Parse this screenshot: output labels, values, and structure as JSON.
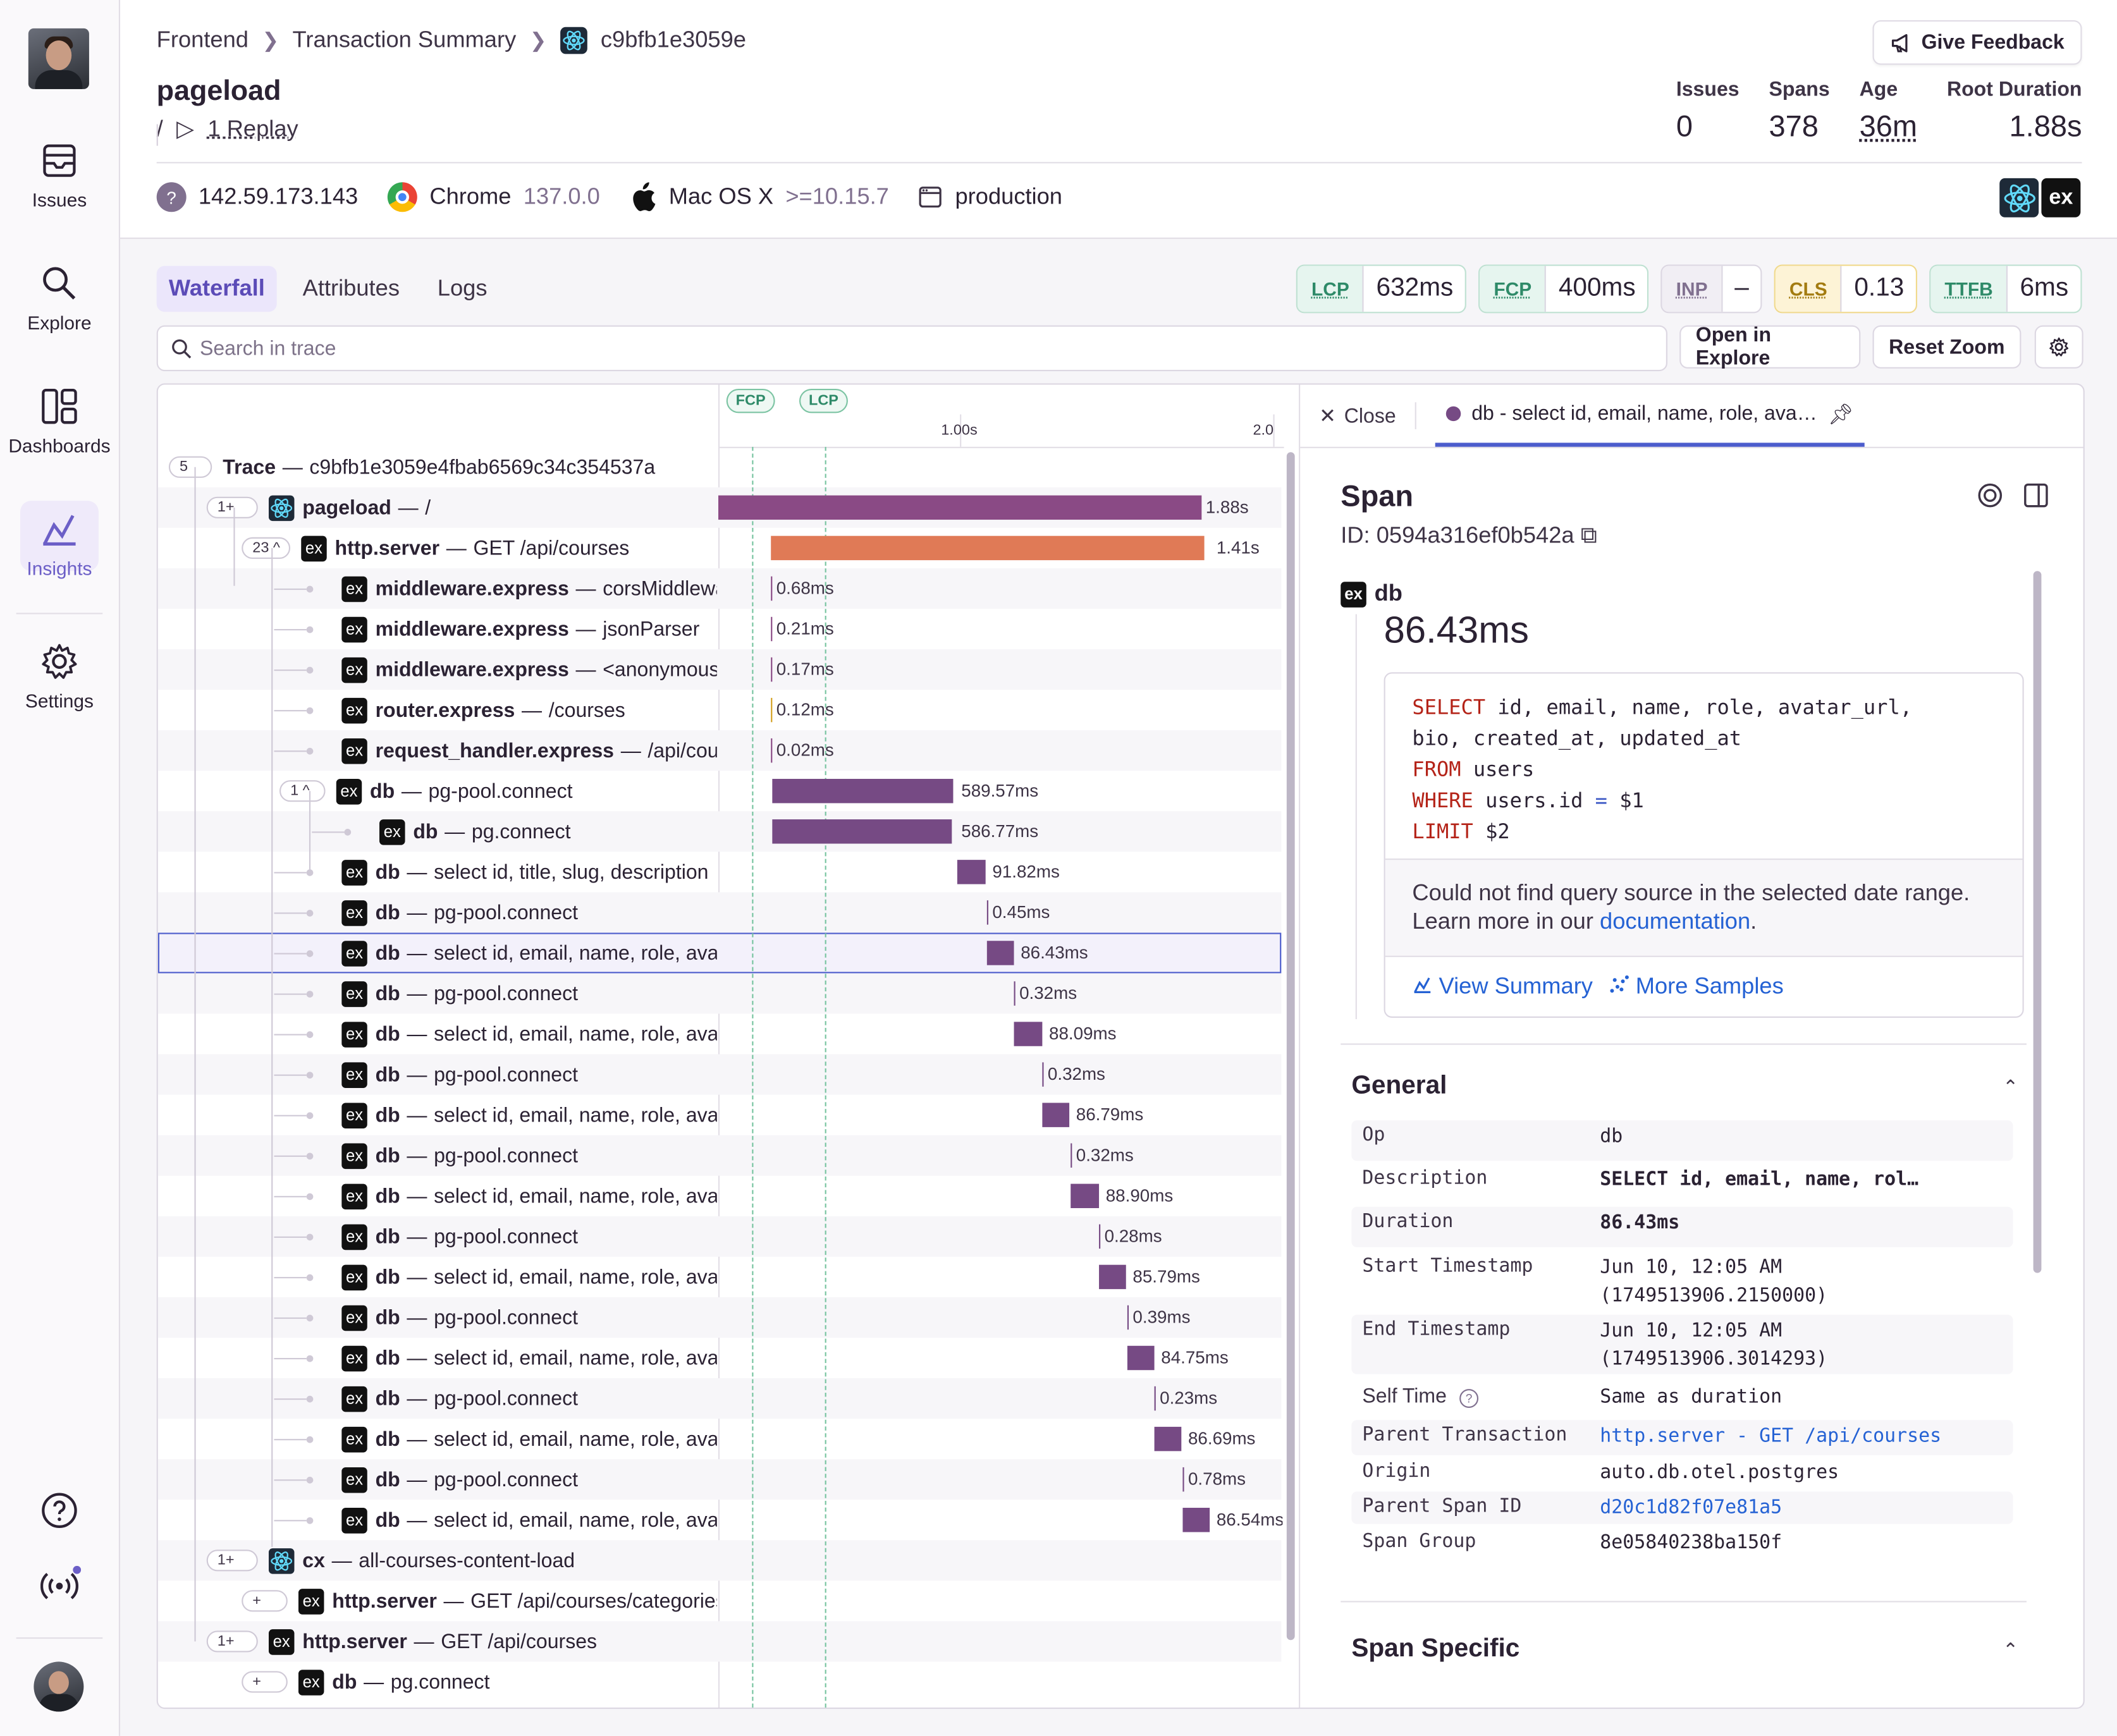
{
  "sidebar": {
    "items": [
      {
        "label": "Issues",
        "icon": "issues-icon"
      },
      {
        "label": "Explore",
        "icon": "search-icon"
      },
      {
        "label": "Dashboards",
        "icon": "dashboards-icon"
      },
      {
        "label": "Insights",
        "icon": "insights-icon"
      },
      {
        "label": "Settings",
        "icon": "gear-icon"
      }
    ],
    "accent": "#6c5fc7"
  },
  "breadcrumbs": [
    "Frontend",
    "Transaction Summary",
    "c9bfb1e3059e"
  ],
  "header": {
    "title": "pageload",
    "route": "/",
    "replay": "1 Replay",
    "feedback": "Give Feedback",
    "stats": [
      {
        "label": "Issues",
        "value": "0"
      },
      {
        "label": "Spans",
        "value": "378"
      },
      {
        "label": "Age",
        "value": "36m"
      },
      {
        "label": "Root Duration",
        "value": "1.88s"
      }
    ],
    "ip": "142.59.173.143",
    "browser": "Chrome",
    "browser_version": "137.0.0",
    "os": "Mac OS X",
    "os_version": ">=10.15.7",
    "environment": "production"
  },
  "tabs": [
    "Waterfall",
    "Attributes",
    "Logs"
  ],
  "vitals": [
    {
      "key": "LCP",
      "value": "632ms"
    },
    {
      "key": "FCP",
      "value": "400ms"
    },
    {
      "key": "INP",
      "value": "–"
    },
    {
      "key": "CLS",
      "value": "0.13"
    },
    {
      "key": "TTFB",
      "value": "6ms"
    }
  ],
  "toolbar": {
    "search_placeholder": "Search in trace",
    "open_explore": "Open in Explore",
    "reset_zoom": "Reset Zoom"
  },
  "timeline": {
    "ticks": [
      "1.00s",
      "2.0"
    ],
    "markers": [
      "FCP",
      "LCP"
    ]
  },
  "trace": {
    "rows": [
      {
        "count": "5",
        "op": "Trace",
        "desc": "c9bfb1e3059e4fbab6569c34c354537a",
        "duration": ""
      },
      {
        "count": "1+",
        "op": "pageload",
        "desc": "/",
        "duration": "1.88s"
      },
      {
        "count": "23",
        "op": "http.server",
        "desc": "GET /api/courses",
        "duration": "1.41s"
      },
      {
        "op": "middleware.express",
        "desc": "corsMiddleware",
        "duration": "0.68ms"
      },
      {
        "op": "middleware.express",
        "desc": "jsonParser",
        "duration": "0.21ms"
      },
      {
        "op": "middleware.express",
        "desc": "<anonymous>",
        "duration": "0.17ms"
      },
      {
        "op": "router.express",
        "desc": "/courses",
        "duration": "0.12ms"
      },
      {
        "op": "request_handler.express",
        "desc": "/api/courses",
        "duration": "0.02ms"
      },
      {
        "count": "1",
        "op": "db",
        "desc": "pg-pool.connect",
        "duration": "589.57ms"
      },
      {
        "op": "db",
        "desc": "pg.connect",
        "duration": "586.77ms"
      },
      {
        "op": "db",
        "desc": "select id, title, slug, description",
        "duration": "91.82ms"
      },
      {
        "op": "db",
        "desc": "pg-pool.connect",
        "duration": "0.45ms"
      },
      {
        "op": "db",
        "desc": "select id, email, name, role, avatar_url",
        "duration": "86.43ms"
      },
      {
        "op": "db",
        "desc": "pg-pool.connect",
        "duration": "0.32ms"
      },
      {
        "op": "db",
        "desc": "select id, email, name, role, avatar_url",
        "duration": "88.09ms"
      },
      {
        "op": "db",
        "desc": "pg-pool.connect",
        "duration": "0.32ms"
      },
      {
        "op": "db",
        "desc": "select id, email, name, role, avatar_url",
        "duration": "86.79ms"
      },
      {
        "op": "db",
        "desc": "pg-pool.connect",
        "duration": "0.32ms"
      },
      {
        "op": "db",
        "desc": "select id, email, name, role, avatar_url",
        "duration": "88.90ms"
      },
      {
        "op": "db",
        "desc": "pg-pool.connect",
        "duration": "0.28ms"
      },
      {
        "op": "db",
        "desc": "select id, email, name, role, avatar_url",
        "duration": "85.79ms"
      },
      {
        "op": "db",
        "desc": "pg-pool.connect",
        "duration": "0.39ms"
      },
      {
        "op": "db",
        "desc": "select id, email, name, role, avatar_url",
        "duration": "84.75ms"
      },
      {
        "op": "db",
        "desc": "pg-pool.connect",
        "duration": "0.23ms"
      },
      {
        "op": "db",
        "desc": "select id, email, name, role, avatar_url",
        "duration": "86.69ms"
      },
      {
        "op": "db",
        "desc": "pg-pool.connect",
        "duration": "0.78ms"
      },
      {
        "op": "db",
        "desc": "select id, email, name, role, avatar_url",
        "duration": "86.54ms"
      },
      {
        "count": "1+",
        "op": "cx",
        "desc": "all-courses-content-load",
        "duration": ""
      },
      {
        "count": "+",
        "op": "http.server",
        "desc": "GET /api/courses/categories",
        "duration": ""
      },
      {
        "count": "1+",
        "op": "http.server",
        "desc": "GET /api/courses",
        "duration": ""
      },
      {
        "count": "+",
        "op": "db",
        "desc": "pg.connect",
        "duration": ""
      }
    ]
  },
  "detail": {
    "close": "Close",
    "tab_label": "db - select id, email, name, role, ava…",
    "title": "Span",
    "id": "ID: 0594a316ef0b542a",
    "op": "db",
    "duration": "86.43ms",
    "sql": {
      "l1_kw": "SELECT",
      "l1": " id, email, name, role, avatar_url,",
      "l2": "bio, created_at, updated_at",
      "l3_kw": "FROM",
      "l3": " users",
      "l4_kw": "WHERE",
      "l4a": " users.id ",
      "l4_op": "=",
      "l4b": " $1",
      "l5_kw": "LIMIT",
      "l5": " $2"
    },
    "note": "Could not find query source in the selected date range. Learn more in our",
    "note_link": "documentation",
    "view_summary": "View Summary",
    "more_samples": "More Samples",
    "general_title": "General",
    "general": [
      {
        "k": "Op",
        "v": "db"
      },
      {
        "k": "Description",
        "v": "SELECT id, email, name, rol…"
      },
      {
        "k": "Duration",
        "v": "86.43ms"
      },
      {
        "k": "Start Timestamp",
        "v": "Jun 10, 12:05 AM",
        "v2": "(1749513906.2150000)"
      },
      {
        "k": "End Timestamp",
        "v": "Jun 10, 12:05 AM",
        "v2": "(1749513906.3014293)"
      },
      {
        "k": "Self Time",
        "v": "Same as duration"
      },
      {
        "k": "Parent Transaction",
        "v": "http.server - GET /api/courses"
      },
      {
        "k": "Origin",
        "v": "auto.db.otel.postgres"
      },
      {
        "k": "Parent Span ID",
        "v": "d20c1d82f07e81a5"
      },
      {
        "k": "Span Group",
        "v": "8e05840238ba150f"
      }
    ],
    "span_specific_title": "Span Specific"
  }
}
